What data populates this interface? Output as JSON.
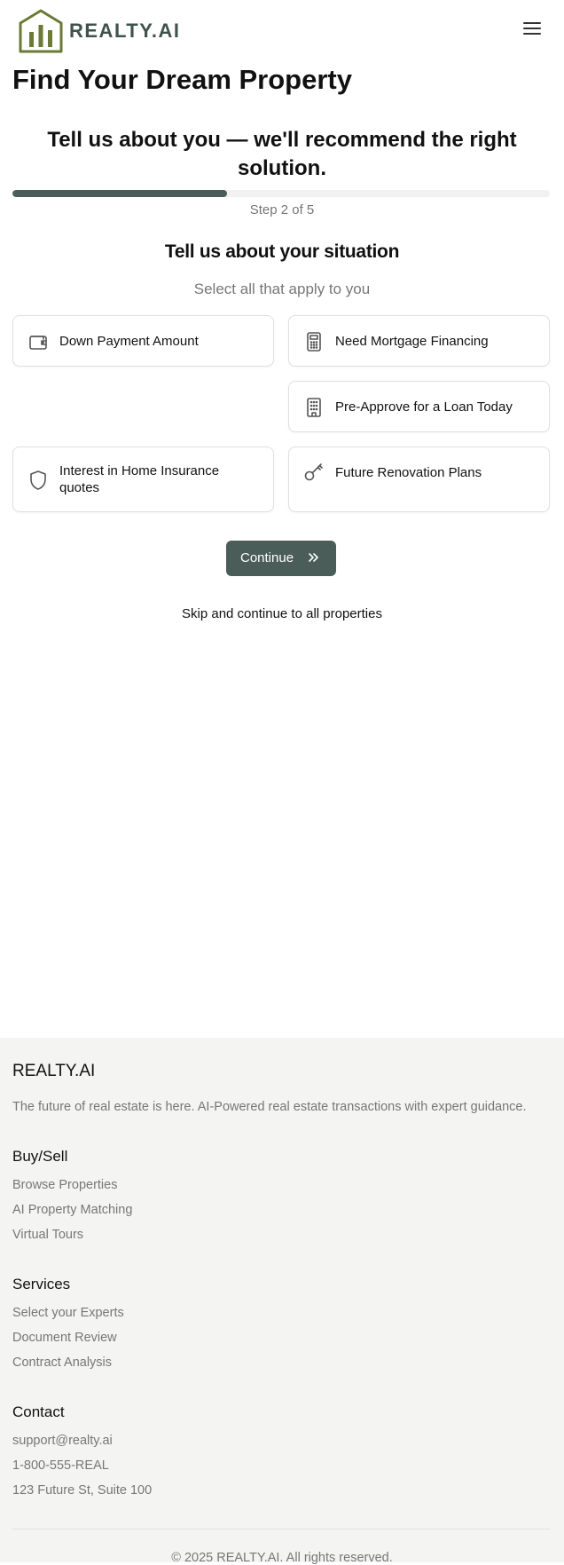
{
  "header": {
    "brand": "REALTY.AI",
    "logo_icon": "house-logo-icon",
    "menu_icon": "hamburger-menu-icon",
    "brand_color": "#3f524c",
    "logo_color": "#6b7a36"
  },
  "main": {
    "title": "Find Your Dream Property",
    "subtitle": "Tell us about you — we'll recommend the right solution.",
    "progress": {
      "current_step": 2,
      "total_steps": 5,
      "fraction": 0.4,
      "label": "Step 2 of 5"
    },
    "section_title": "Tell us about your situation",
    "section_subtitle": "Select all that apply to you",
    "options": [
      {
        "label": "Down Payment Amount",
        "icon": "wallet-icon"
      },
      {
        "label": "Need Mortgage Financing",
        "icon": "calculator-icon"
      },
      {
        "label": "Pre-Approve for a Loan Today",
        "icon": "building-icon"
      },
      {
        "label": "Interest in Home Insurance quotes",
        "icon": "shield-icon"
      },
      {
        "label": "Future Renovation Plans",
        "icon": "key-icon"
      }
    ],
    "continue_label": "Continue",
    "continue_icon": "chevrons-right-icon",
    "skip_label": "Skip and continue to all properties",
    "accent_color": "#4a5d58"
  },
  "footer": {
    "brand": "REALTY.AI",
    "tagline": "The future of real estate is here. AI-Powered real estate transactions with expert guidance.",
    "columns": [
      {
        "heading": "Buy/Sell",
        "links": [
          "Browse Properties",
          "AI Property Matching",
          "Virtual Tours"
        ]
      },
      {
        "heading": "Services",
        "links": [
          "Select your Experts",
          "Document Review",
          "Contract Analysis"
        ]
      },
      {
        "heading": "Contact",
        "links": [
          "support@realty.ai",
          "1-800-555-REAL",
          "123 Future St, Suite 100"
        ]
      }
    ],
    "copyright": "© 2025 REALTY.AI. All rights reserved."
  }
}
